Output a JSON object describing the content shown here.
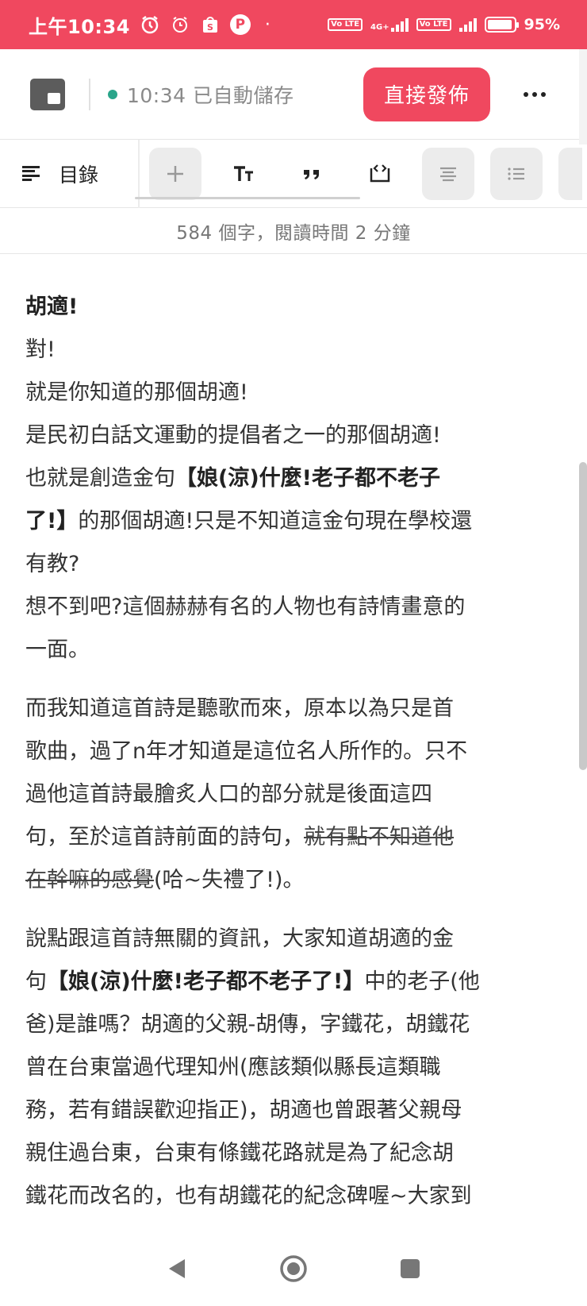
{
  "status_bar": {
    "time": "上午10:34",
    "network": "4G+",
    "volte1": "Vo LTE",
    "volte2": "Vo LTE",
    "battery": "95%",
    "battery_level": 0.95,
    "icons": [
      "alarm-clock-icon",
      "alarm-icon",
      "shopee-icon",
      "parking-icon",
      "dot-icon"
    ]
  },
  "app_bar": {
    "autosave_time": "10:34",
    "autosave_text": "已自動儲存",
    "publish_label": "直接發佈",
    "more_label": "more"
  },
  "toolbar": {
    "toc_label": "目錄",
    "tools": [
      "add-icon",
      "text-size-icon",
      "quote-icon",
      "code-block-icon",
      "align-icon",
      "list-icon"
    ]
  },
  "word_count": "584 個字，閱讀時間 2 分鐘",
  "article": {
    "p1": {
      "l1": "胡適!",
      "l2": "對!",
      "l3": "就是你知道的那個胡適!",
      "l4": "是民初白話文運動的提倡者之一的那個胡適!",
      "l5a": "也就是創造金句",
      "l5b": "【",
      "l5c": "娘(涼)什麼!老子都不老子",
      "l6a": "了!",
      "l6b": "】",
      "l6c": "的那個胡適!只是不知道這金句現在學校還",
      "l7": "有教?",
      "l8": "想不到吧?這個赫赫有名的人物也有詩情畫意的",
      "l9": "一面。"
    },
    "p2": {
      "l1": "而我知道這首詩是聽歌而來，原本以為只是首",
      "l2": "歌曲，過了n年才知道是這位名人所作的。只不",
      "l3": "過他這首詩最膾炙人口的部分就是後面這四",
      "l4a": "句，至於這首詩前面的詩句，",
      "l4b": "就有點不知道他",
      "l5a": "在幹嘛的感覺",
      "l5b": "(哈~失禮了!)。"
    },
    "p3": {
      "l1": "說點跟這首詩無關的資訊，大家知道胡適的金",
      "l2a": "句",
      "l2b": "【",
      "l2c": "娘(涼)什麼!老子都不老子了!",
      "l2d": "】",
      "l2e": "中的老子(他",
      "l3": "爸)是誰嗎？胡適的父親-胡傳，字鐵花，胡鐵花",
      "l4": "曾在台東當過代理知州(應該類似縣長這類職",
      "l5": "務，若有錯誤歡迎指正)，胡適也曾跟著父親母",
      "l6": "親住過台東，台東有條鐵花路就是為了紀念胡",
      "l7": "鐵花而改名的，也有胡鐵花的紀念碑喔~大家到"
    }
  },
  "nav_bar": {
    "buttons": [
      "back-icon",
      "home-icon",
      "recents-icon"
    ]
  }
}
